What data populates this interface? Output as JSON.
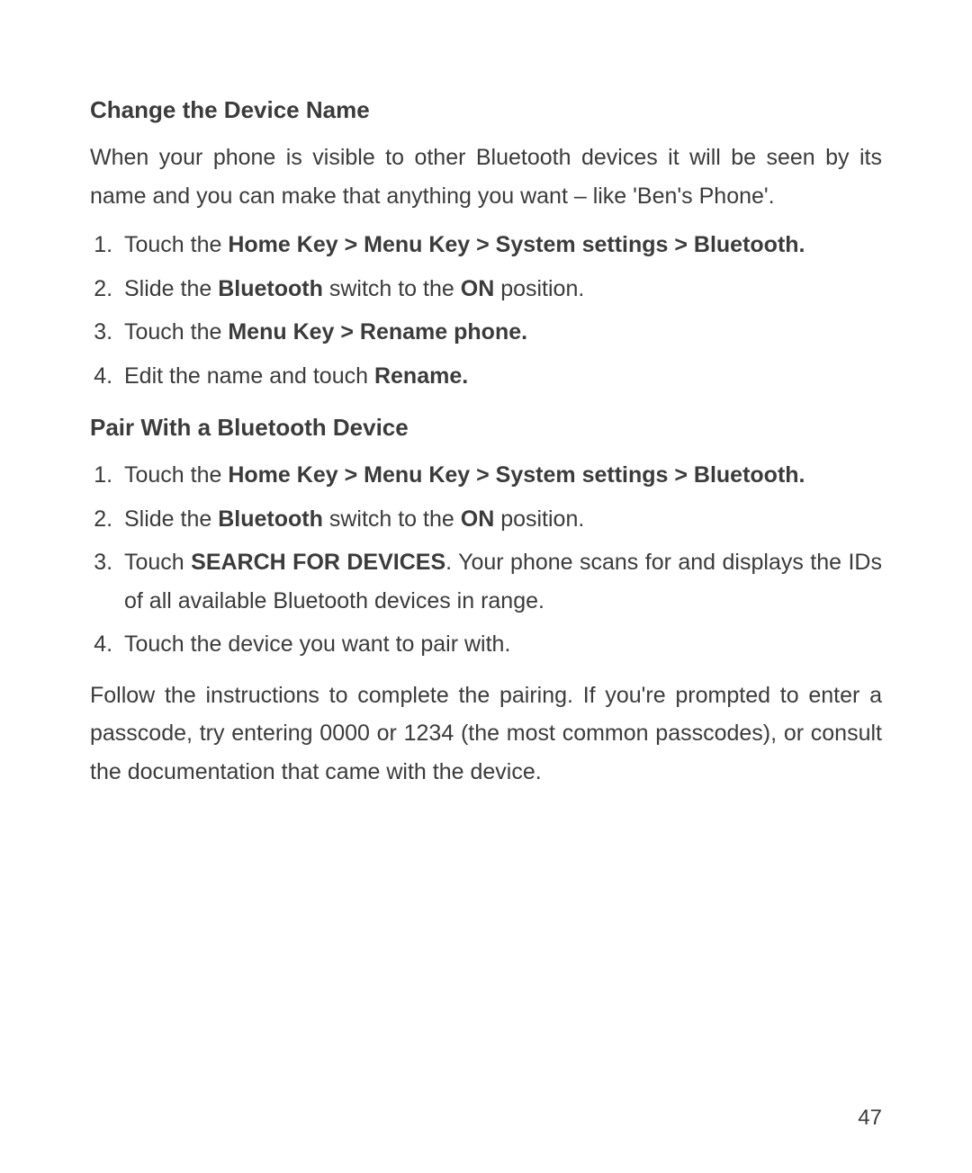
{
  "page_number": "47",
  "section1": {
    "heading": "Change the Device Name",
    "intro": "When your phone is visible to other Bluetooth devices it will be seen by its name and you can make that anything you want – like 'Ben's Phone'.",
    "step1_a": "Touch the ",
    "step1_b": "Home Key > Menu Key > System settings > Bluetooth.",
    "step2_a": "Slide the ",
    "step2_b": "Bluetooth",
    "step2_c": " switch to the ",
    "step2_d": "ON",
    "step2_e": " position.",
    "step3_a": "Touch the ",
    "step3_b": "Menu Key > Rename phone.",
    "step4_a": "Edit the name and touch ",
    "step4_b": "Rename."
  },
  "section2": {
    "heading": "Pair With a Bluetooth Device",
    "step1_a": "Touch the ",
    "step1_b": "Home Key > Menu Key > System settings > Bluetooth.",
    "step2_a": "Slide the ",
    "step2_b": "Bluetooth",
    "step2_c": " switch to the ",
    "step2_d": "ON",
    "step2_e": " position.",
    "step3_a": "Touch ",
    "step3_b": "SEARCH FOR DEVICES",
    "step3_c": ". Your phone scans for and displays the IDs of all available Bluetooth devices in range.",
    "step4": "Touch the device you want to pair with.",
    "outro": "Follow the instructions to complete the pairing. If you're prompted to enter a passcode, try entering 0000 or 1234 (the most common passcodes), or consult the documentation that came with the device."
  }
}
